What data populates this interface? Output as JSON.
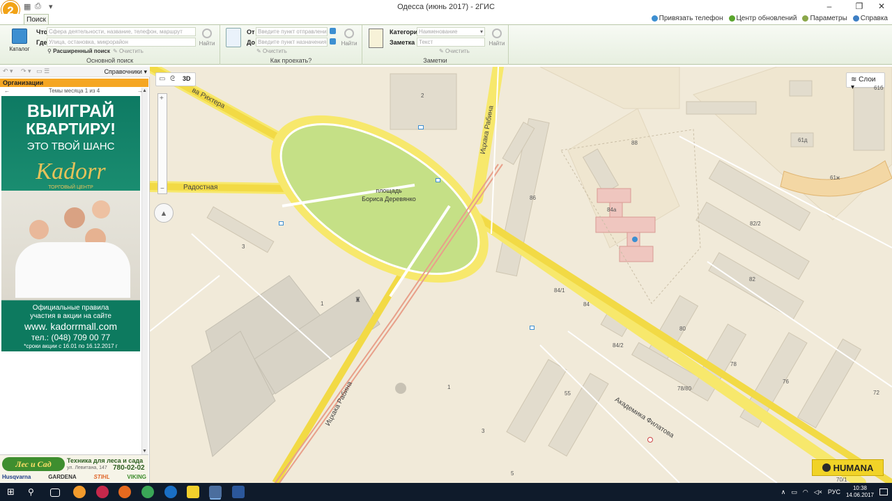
{
  "window": {
    "title": "Одесса (июнь 2017) - 2ГИС",
    "logo_text": "2",
    "minimize": "–",
    "maximize": "❐",
    "close": "✕"
  },
  "tabs": {
    "search": "Поиск"
  },
  "top_links": {
    "phone": "Привязать телефон",
    "updates": "Центр обновлений",
    "settings": "Параметры",
    "help": "Справка"
  },
  "ribbon": {
    "catalog": "Каталог",
    "main_search": {
      "what_label": "Что",
      "what_placeholder": "Сфера деятельности, название, телефон, маршрут",
      "where_label": "Где",
      "where_placeholder": "Улица, остановка, микрорайон",
      "advanced": "Расширенный поиск",
      "clear": "Очистить",
      "find": "Найти",
      "title": "Основной поиск"
    },
    "route": {
      "from_label": "От",
      "from_placeholder": "Введите пункт отправления",
      "to_label": "До",
      "to_placeholder": "Введите пункт назначения",
      "clear": "Очистить",
      "find": "Найти",
      "title": "Как проехать?"
    },
    "notes": {
      "category_label": "Категория",
      "category_value": "Наименование",
      "note_label": "Заметка",
      "note_placeholder": "Текст",
      "clear": "Очистить",
      "find": "Найти",
      "title": "Заметки"
    }
  },
  "left_panel": {
    "directories": "Справочники",
    "org_header": "Организации",
    "themes": "Темы месяца 1 из 4",
    "ad": {
      "line1": "ВЫИГРАЙ",
      "line2": "КВАРТИРУ!",
      "line3": "ЭТО ТВОЙ ШАНС",
      "brand": "Kadorr",
      "brand_sub": "ТОРГОВЫЙ ЦЕНТР",
      "rules1": "Официальные правила",
      "rules2": "участия в акции на сайте",
      "site": "www. kadorrmall.com",
      "phone": "тел.: (048) 709 00 77",
      "terms": "*сроки акции с 16.01 по 16.12.2017 г"
    },
    "bottom_ad": {
      "logo": "Лес и Сад",
      "tagline": "Техника для леса и сада",
      "address": "ул. Левитана, 147",
      "phone": "780-02-02",
      "brands": [
        "Husqvarna",
        "GARDENA",
        "STIHL",
        "VIKING"
      ]
    }
  },
  "map": {
    "btn_3d": "3D",
    "layers": "Слои",
    "square_label_1": "площадь",
    "square_label_2": "Бориса Деревянко",
    "streets": {
      "richter": "ва Рихтера",
      "radostnaya": "Радостная",
      "rabina_top": "Ицхака Рабина",
      "rabina_bottom": "Ицхака Рабина",
      "filatova": "Академика Филатова"
    },
    "building_numbers": [
      "2",
      "88",
      "61д",
      "61ж",
      "86",
      "84а",
      "82/2",
      "82",
      "3",
      "1",
      "84/1",
      "84",
      "84/2",
      "80",
      "78",
      "76",
      "78/80",
      "55",
      "1",
      "3",
      "5",
      "72",
      "70/1",
      "61б"
    ],
    "ad_brand": "HUMANA"
  },
  "taskbar": {
    "lang": "РУС",
    "time": "10:38",
    "date": "14.06.2017"
  }
}
